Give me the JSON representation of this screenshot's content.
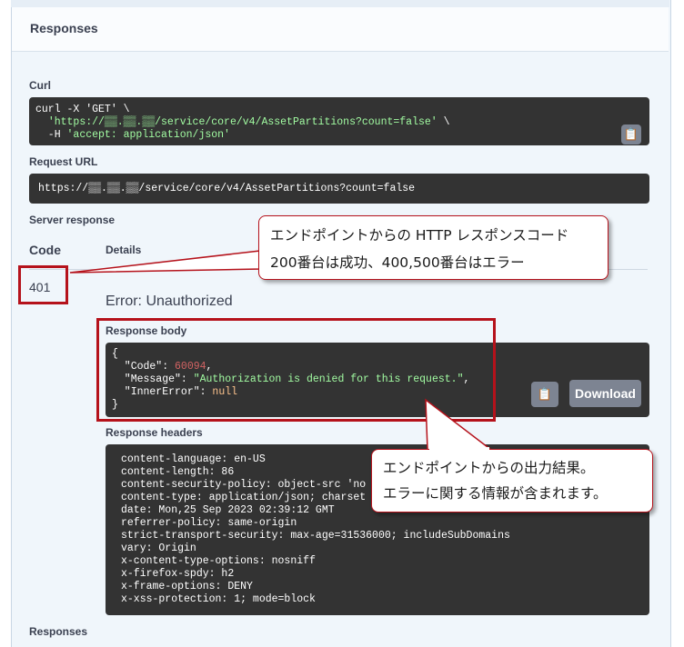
{
  "responses_header": {
    "title": "Responses"
  },
  "curl": {
    "label": "Curl",
    "line1": "curl -X 'GET' \\",
    "url": "'https://▒▒.▒▒.▒▒/service/core/v4/AssetPartitions?count=false'",
    "cont": " \\",
    "h_flag": "  -H ",
    "h_value": "'accept: application/json'"
  },
  "request_url": {
    "label": "Request URL",
    "value": "https://▒▒.▒▒.▒▒/service/core/v4/AssetPartitions?count=false"
  },
  "server_response": {
    "label": "Server response",
    "code_header": "Code",
    "details_header": "Details",
    "code": "401",
    "error": "Error: Unauthorized",
    "body_label": "Response body",
    "body": {
      "open": "{",
      "code_key": "  \"Code\": ",
      "code_val": "60094",
      "message_key": "  \"Message\": ",
      "message_val": "\"Authorization is denied for this request.\"",
      "inner_key": "  \"InnerError\": ",
      "inner_val": "null",
      "close": "}"
    },
    "download_label": "Download",
    "headers_label": "Response headers",
    "headers": [
      "content-language: en-US",
      "content-length: 86",
      "content-security-policy: object-src 'no",
      "content-type: application/json; charset",
      "date: Mon,25 Sep 2023 02:39:12 GMT",
      "referrer-policy: same-origin",
      "strict-transport-security: max-age=31536000; includeSubDomains",
      "vary: Origin",
      "x-content-type-options: nosniff",
      "x-firefox-spdy: h2",
      "x-frame-options: DENY",
      "x-xss-protection: 1; mode=block"
    ]
  },
  "footer_label": "Responses",
  "callout_top": {
    "line1": "エンドポイントからの  HTTP  レスポンスコード",
    "line2": "200番台は成功、400,500番台はエラー"
  },
  "callout_bottom": {
    "line1": "エンドポイントからの出力結果。",
    "line2": "エラーに関する情報が含まれます。"
  },
  "copy_icon": "clipboard-icon",
  "colors": {
    "accent_red": "#b5121b",
    "panel_dark": "#333333",
    "string_green": "#a2fca2",
    "number_red": "#d36363",
    "null_orange": "#fcc28c"
  }
}
